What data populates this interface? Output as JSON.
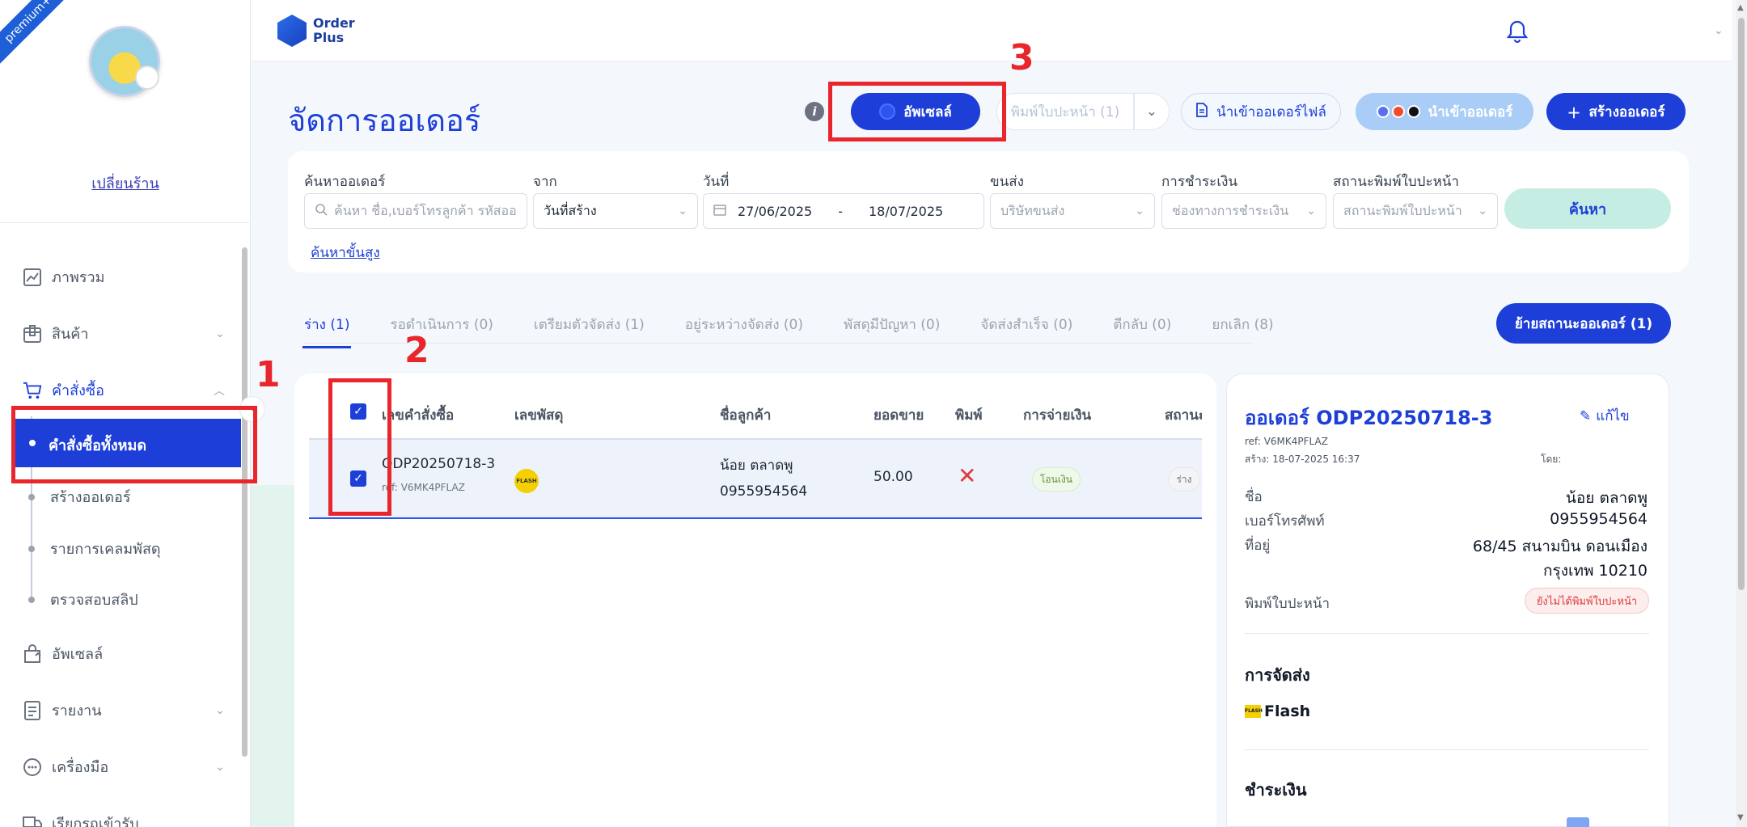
{
  "sidebar": {
    "premium": "premium+",
    "change_shop": "เปลี่ยนร้าน",
    "items": [
      {
        "label": "ภาพรวม",
        "icon": "chart-icon"
      },
      {
        "label": "สินค้า",
        "icon": "box-icon"
      },
      {
        "label": "คำสั่งซื้อ",
        "icon": "cart-icon"
      },
      {
        "label": "อัพเซลล์",
        "icon": "upsell-icon"
      },
      {
        "label": "รายงาน",
        "icon": "report-icon"
      },
      {
        "label": "เครื่องมือ",
        "icon": "chat-icon"
      },
      {
        "label": "เรียกรถเข้ารับ",
        "icon": "truck-icon"
      }
    ],
    "sub_items": [
      "คำสั่งซื้อทั้งหมด",
      "สร้างออเดอร์",
      "รายการเคลมพัสดุ",
      "ตรวจสอบสลิป"
    ]
  },
  "header": {
    "logo_line1": "Order",
    "logo_line2": "Plus"
  },
  "page": {
    "title": "จัดการออเดอร์",
    "buttons": {
      "upsell": "อัพเซลล์",
      "print": "พิมพ์ใบปะหน้า (1)",
      "import_file": "นำเข้าออเดอร์ไฟล์",
      "import_marketplace": "นำเข้าออเดอร์",
      "create": "สร้างออเดอร์"
    }
  },
  "annotations": {
    "a1": "1",
    "a2": "2",
    "a3": "3"
  },
  "filters": {
    "search_label": "ค้นหาออเดอร์",
    "search_placeholder": "ค้นหา ชื่อ,เบอร์โทรลูกค้า รหัสออ",
    "from_label": "จาก",
    "from_value": "วันที่สร้าง",
    "date_label": "วันที่",
    "date_from": "27/06/2025",
    "date_sep": "-",
    "date_to": "18/07/2025",
    "shipping_label": "ขนส่ง",
    "shipping_placeholder": "บริษัทขนส่ง",
    "payment_label": "การชำระเงิน",
    "payment_placeholder": "ช่องทางการชำระเงิน",
    "print_status_label": "สถานะพิมพ์ใบปะหน้า",
    "print_status_placeholder": "สถานะพิมพ์ใบปะหน้า",
    "search_button": "ค้นหา",
    "advanced": "ค้นหาขั้นสูง"
  },
  "tabs": [
    "ร่าง (1)",
    "รอดำเนินการ (0)",
    "เตรียมตัวจัดส่ง (1)",
    "อยู่ระหว่างจัดส่ง (0)",
    "พัสดุมีปัญหา (0)",
    "จัดส่งสำเร็จ (0)",
    "ตีกลับ (0)",
    "ยกเลิก (8)"
  ],
  "move_status_button": "ย้ายสถานะออเดอร์ (1)",
  "table": {
    "headers": [
      "เลขคำสั่งซื้อ",
      "เลขพัสดุ",
      "ชื่อลูกค้า",
      "ยอดขาย",
      "พิมพ์",
      "การจ่ายเงิน",
      "สถานะ"
    ],
    "rows": [
      {
        "order_no": "ODP20250718-3",
        "ref": "ref: V6MK4PFLAZ",
        "carrier_logo": "FLASH",
        "customer_name": "น้อย ตลาดพู",
        "customer_phone": "0955954564",
        "amount": "50.00",
        "printed": "✕",
        "payment": "โอนเงิน",
        "status": "ร่าง"
      }
    ]
  },
  "detail": {
    "title": "ออเดอร์ ODP20250718-3",
    "edit": "แก้ไข",
    "ref": "ref: V6MK4PFLAZ",
    "created": "สร้าง: 18-07-2025 16:37",
    "by": "โดย:",
    "name_label": "ชื่อ",
    "name_value": "น้อย ตลาดพู",
    "phone_label": "เบอร์โทรศัพท์",
    "phone_value": "0955954564",
    "address_label": "ที่อยู่",
    "address_line1": "68/45 สนามบิน ดอนเมือง",
    "address_line2": "กรุงเทพ 10210",
    "print_label": "พิมพ์ใบปะหน้า",
    "print_badge": "ยังไม่ได้พิมพ์ใบปะหน้า",
    "shipping_section": "การจัดส่ง",
    "carrier": "Flash",
    "carrier_logo": "FLASH",
    "payment_section": "ชำระเงิน"
  },
  "colors": {
    "primary": "#1d3fd8",
    "annotation": "#e8262c",
    "search_button": "#c6ede3"
  }
}
